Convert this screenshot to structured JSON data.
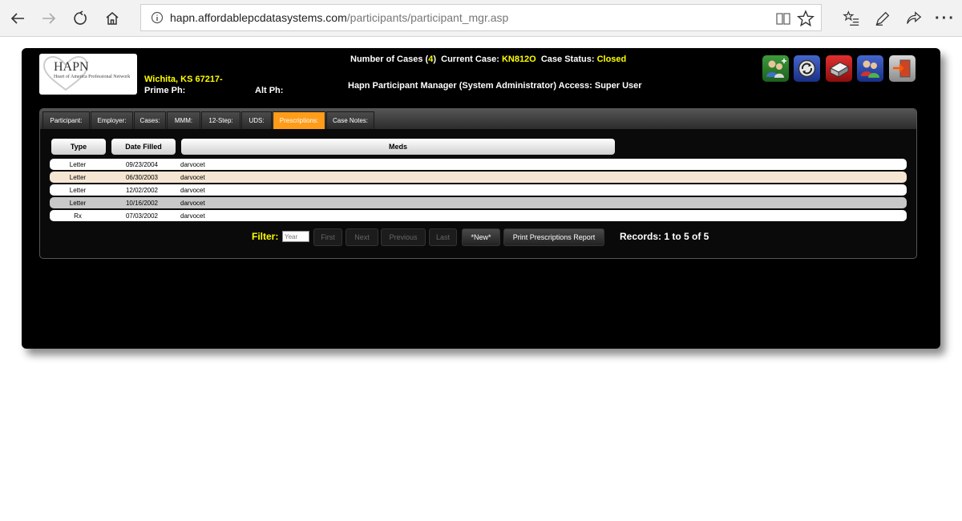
{
  "browser": {
    "url_domain": "hapn.affordablepcdatasystems.com",
    "url_path": "/participants/participant_mgr.asp"
  },
  "header": {
    "logo_title": "HAPN",
    "logo_subtitle": "Heart of America Professional Network",
    "city": "Wichita, KS 67217-",
    "prime_ph_label": "Prime Ph:",
    "alt_ph_label": "Alt Ph:",
    "cases_label": "Number of Cases (",
    "cases_count": "4",
    "cases_close": ")",
    "current_case_label": "Current Case:",
    "current_case": "KN812O",
    "status_label": "Case Status:",
    "status": "Closed",
    "access_line": "Hapn Participant Manager (System Administrator) Access: Super User"
  },
  "toolbar_icons": [
    "participants-icon",
    "refresh-icon",
    "print-icon",
    "users-icon",
    "logout-icon"
  ],
  "tabs": [
    {
      "label": "Participant:"
    },
    {
      "label": "Employer:"
    },
    {
      "label": "Cases:"
    },
    {
      "label": "MMM:"
    },
    {
      "label": "12-Step:"
    },
    {
      "label": "UDS:"
    },
    {
      "label": "Prescriptions:"
    },
    {
      "label": "Case Notes:"
    }
  ],
  "active_tab": "Prescriptions:",
  "columns": [
    "Type",
    "Date Filled",
    "Meds"
  ],
  "rows": [
    {
      "type": "Letter",
      "date": "09/23/2004",
      "meds": "darvocet"
    },
    {
      "type": "Letter",
      "date": "06/30/2003",
      "meds": "darvocet"
    },
    {
      "type": "Letter",
      "date": "12/02/2002",
      "meds": "darvocet"
    },
    {
      "type": "Letter",
      "date": "10/16/2002",
      "meds": "darvocet"
    },
    {
      "type": "Rx",
      "date": "07/03/2002",
      "meds": "darvocet"
    }
  ],
  "pager": {
    "filter_label": "Filter:",
    "filter_placeholder": "Year",
    "first": "First",
    "next": "Next",
    "previous": "Previous",
    "last": "Last",
    "new": "*New*",
    "print_report": "Print Prescriptions Report",
    "records": "Records: 1 to 5 of 5"
  },
  "colors": {
    "accent_tab": "#ff9c1a",
    "highlight_text": "#ffff00",
    "row_alt_a": "#ffffff",
    "row_alt_b": "#f5e6d3",
    "row_alt_c": "#c8c8c8"
  }
}
